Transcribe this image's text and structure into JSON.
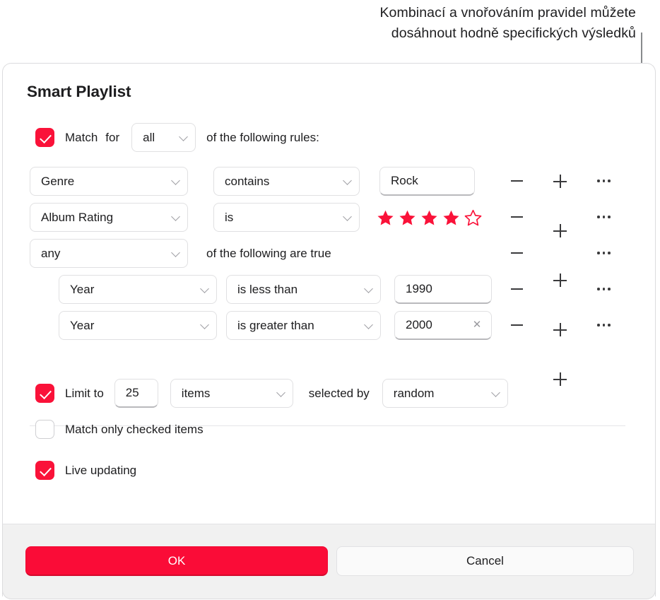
{
  "caption": {
    "line1": "Kombinací a vnořováním pravidel můžete",
    "line2": "dosáhnout hodně specifických výsledků"
  },
  "dialog": {
    "title": "Smart Playlist",
    "match": {
      "checked": true,
      "label_match": "Match",
      "label_for": "for",
      "scope_value": "all",
      "suffix": "of the following rules:"
    },
    "rules": [
      {
        "field": "Genre",
        "operator": "contains",
        "value": "Rock",
        "value_type": "text"
      },
      {
        "field": "Album Rating",
        "operator": "is",
        "value_type": "stars",
        "stars_filled": 4,
        "stars_total": 5
      },
      {
        "field": "any",
        "value_type": "group",
        "group_suffix": "of the following are true"
      },
      {
        "field": "Year",
        "operator": "is less than",
        "value": "1990",
        "value_type": "text",
        "nested": true
      },
      {
        "field": "Year",
        "operator": "is greater than",
        "value": "2000",
        "value_type": "text",
        "nested": true,
        "clearable": true,
        "clear_glyph": "✕"
      }
    ],
    "row_actions": {
      "remove": "remove-rule",
      "add": "add-rule",
      "more": "more-options"
    },
    "limit": {
      "checked": true,
      "label": "Limit to",
      "amount": "25",
      "unit": "items",
      "selected_by_label": "selected by",
      "selected_by": "random"
    },
    "match_only_checked": {
      "checked": false,
      "label": "Match only checked items"
    },
    "live_updating": {
      "checked": true,
      "label": "Live updating"
    },
    "footer": {
      "ok": "OK",
      "cancel": "Cancel"
    }
  },
  "colors": {
    "accent_red": "#fa1239",
    "ok_button": "#fa0c37",
    "star_red": "#fa1239",
    "text": "#1d1d1f",
    "footer_bg": "#f1f1f1",
    "callout_gray": "#8a8c8e"
  }
}
